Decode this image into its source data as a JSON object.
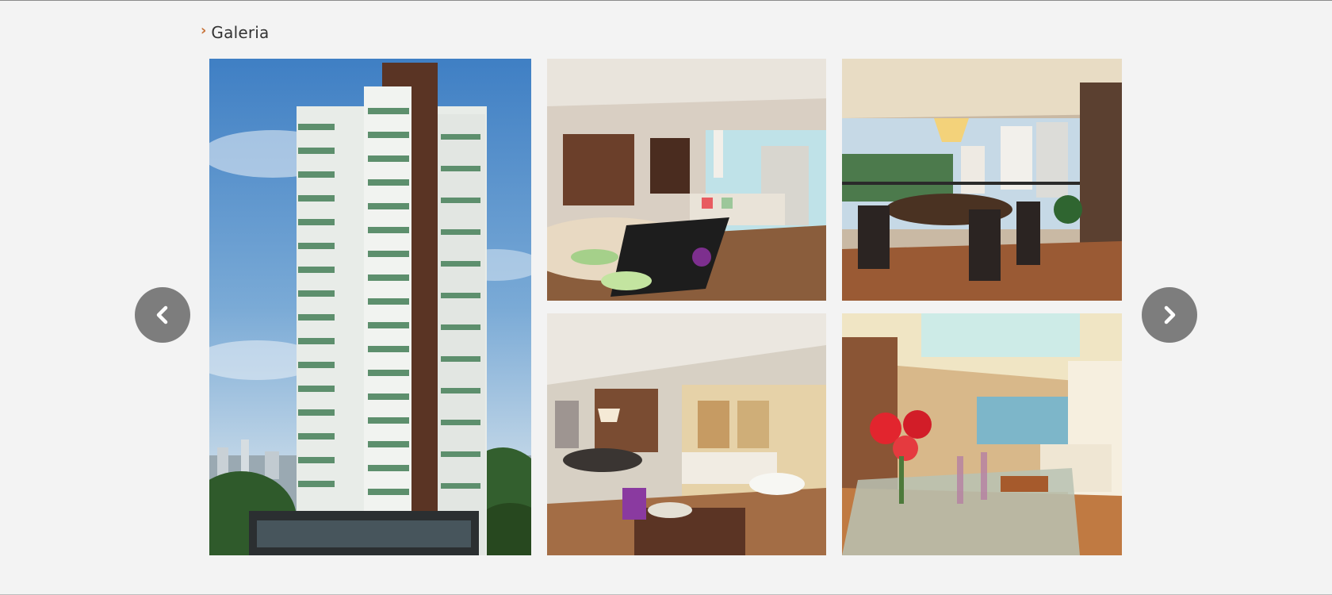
{
  "gallery": {
    "title": "Galeria",
    "title_icon": "chevron-right-icon",
    "accent_color": "#c8743a",
    "prev_icon": "chevron-left-icon",
    "next_icon": "chevron-right-icon",
    "nav_button_color": "#7d7d7d",
    "photos": [
      {
        "subject": "building-exterior"
      },
      {
        "subject": "living-room-balcony"
      },
      {
        "subject": "dining-balcony"
      },
      {
        "subject": "dining-and-lounge"
      },
      {
        "subject": "table-setting"
      }
    ]
  }
}
